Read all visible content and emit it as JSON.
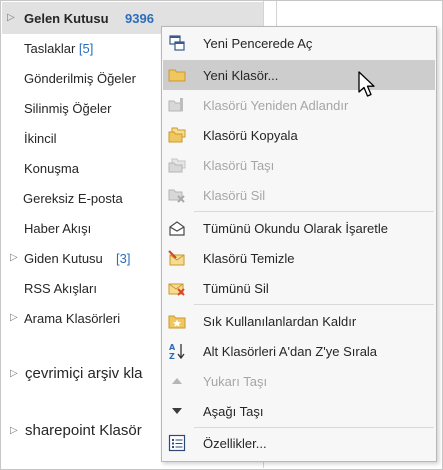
{
  "folders": {
    "inbox": {
      "label": "Gelen Kutusu",
      "count": "9396"
    },
    "drafts": {
      "label": "Taslaklar",
      "count": "[5]"
    },
    "sent": "Gönderilmiş Öğeler",
    "deleted": "Silinmiş Öğeler",
    "secondary": "İkincil",
    "conversation": "Konuşma",
    "junk": "Gereksiz E-posta",
    "rss_feed": "Haber Akışı",
    "outbox": {
      "label": "Giden Kutusu",
      "count": "[3]"
    },
    "rss": "RSS Akışları",
    "search": "Arama Klasörleri",
    "archive": "çevrimiçi arşiv kla",
    "sharepoint": "sharepoint Klasör"
  },
  "menu": {
    "new_window": "Yeni Pencerede Aç",
    "new_folder": "Yeni Klasör...",
    "rename": "Klasörü Yeniden Adlandır",
    "copy": "Klasörü Kopyala",
    "move": "Klasörü Taşı",
    "delete": "Klasörü Sil",
    "mark_read": "Tümünü Okundu Olarak İşaretle",
    "clean": "Klasörü Temizle",
    "delete_all": "Tümünü Sil",
    "remove_fav": "Sık Kullanılanlardan Kaldır",
    "sort_subfolders": "Alt Klasörleri A'dan Z'ye Sırala",
    "move_up": "Yukarı Taşı",
    "move_down": "Aşağı Taşı",
    "properties": "Özellikler..."
  },
  "colors": {
    "accent_blue": "#2a6ebb",
    "highlight": "#cdcdcd",
    "folder_yellow": "#f0c75e",
    "danger_red": "#d9472b"
  }
}
